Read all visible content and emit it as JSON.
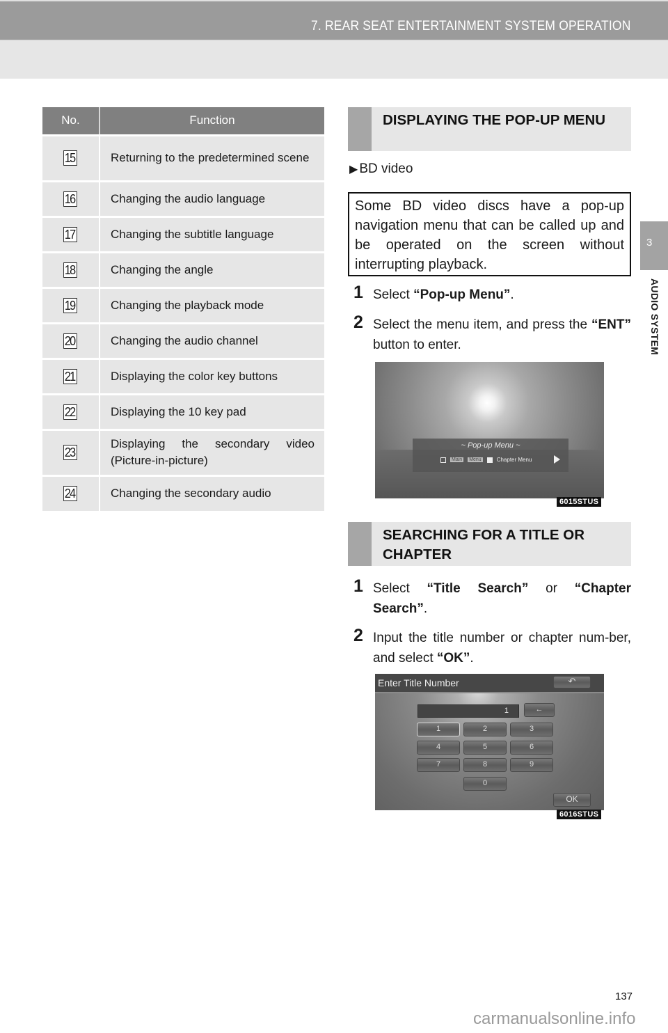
{
  "header": {
    "title": "7. REAR SEAT ENTERTAINMENT SYSTEM OPERATION"
  },
  "side_tab": {
    "number": "3",
    "label": "AUDIO SYSTEM"
  },
  "table": {
    "headers": [
      "No.",
      "Function"
    ],
    "rows": [
      {
        "no": "15",
        "function": "Returning to the predetermined scene"
      },
      {
        "no": "16",
        "function": "Changing the audio language"
      },
      {
        "no": "17",
        "function": "Changing the subtitle language"
      },
      {
        "no": "18",
        "function": "Changing the angle"
      },
      {
        "no": "19",
        "function": "Changing the playback mode"
      },
      {
        "no": "20",
        "function": "Changing the audio channel"
      },
      {
        "no": "21",
        "function": "Displaying the color key buttons"
      },
      {
        "no": "22",
        "function": "Displaying the 10 key pad"
      },
      {
        "no": "23",
        "function": "Displaying the secondary video (Picture-in-picture)"
      },
      {
        "no": "24",
        "function": "Changing the secondary audio"
      }
    ]
  },
  "section_popup": {
    "heading": "DISPLAYING THE POP-UP MENU",
    "bullet_icon": "play-triangle-icon",
    "bullet": "BD video",
    "note": "Some BD video discs have a pop-up navigation menu that can be called up and be operated on the screen without interrupting playback.",
    "steps": [
      {
        "n": "1",
        "pre": "Select ",
        "bold": "“Pop-up Menu”",
        "post": "."
      },
      {
        "n": "2",
        "pre": "Select the menu item, and press the ",
        "bold": "“ENT”",
        "post": " button to enter."
      }
    ],
    "screenshot": {
      "menu_title": "~ Pop-up Menu ~",
      "item_main_a": "Main",
      "item_main_b": "Menu",
      "item_chapter": "Chapter Menu",
      "code": "6015STUS"
    }
  },
  "section_search": {
    "heading": "SEARCHING FOR A TITLE OR CHAPTER",
    "steps": [
      {
        "n": "1",
        "pre": "Select ",
        "bold": "“Title Search”",
        "mid": " or ",
        "bold2": "“Chapter Search”",
        "post": "."
      },
      {
        "n": "2",
        "pre": "Input the title number or chapter num-ber, and select ",
        "bold": "“OK”",
        "post": "."
      }
    ],
    "screenshot": {
      "title": "Enter Title Number",
      "input_value": "1",
      "keys": [
        "1",
        "2",
        "3",
        "4",
        "5",
        "6",
        "7",
        "8",
        "9",
        "0"
      ],
      "selected_key": "1",
      "ok_label": "OK",
      "back_icon": "return-arrow-icon",
      "delete_icon": "backspace-arrow-icon",
      "code": "6016STUS"
    }
  },
  "page_number": "137",
  "watermark": "carmanualsonline.info"
}
